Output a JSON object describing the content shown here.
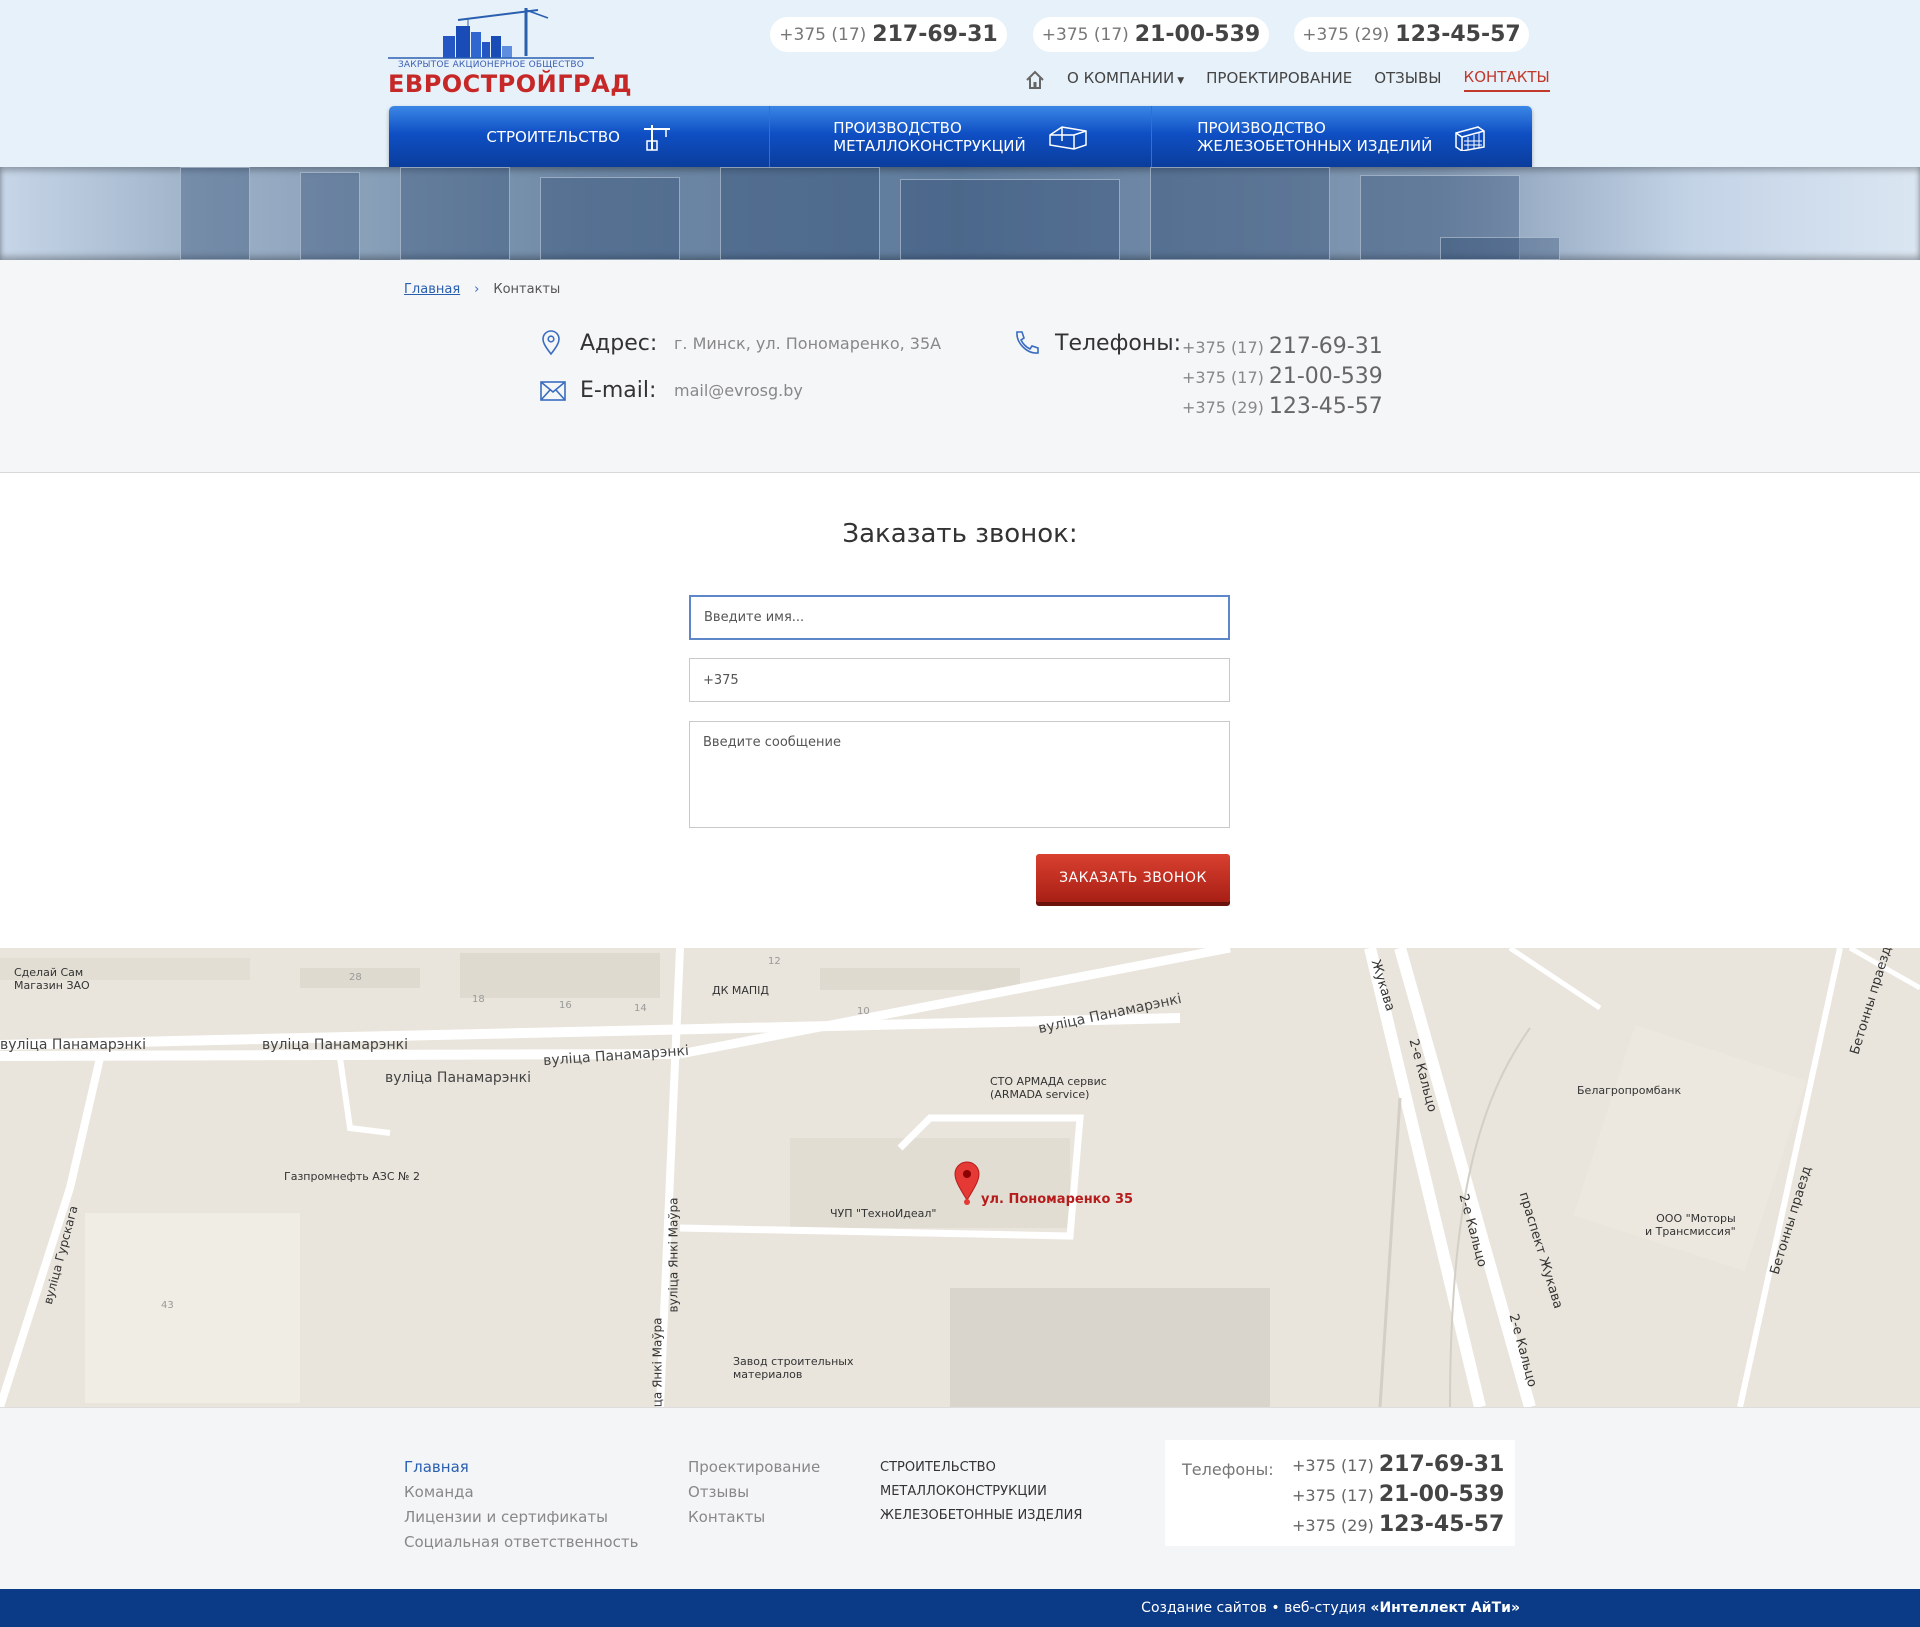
{
  "header": {
    "logo_subtitle": "ЗАКРЫТОЕ АКЦИОНЕРНОЕ ОБЩЕСТВО",
    "logo_name": "ЕВРОСТРОЙГРАД",
    "phones": [
      {
        "code": "+375 (17)",
        "number": "217-69-31"
      },
      {
        "code": "+375 (17)",
        "number": "21-00-539"
      },
      {
        "code": "+375 (29)",
        "number": "123-45-57"
      }
    ],
    "topnav": {
      "about": "О КОМПАНИИ",
      "design": "ПРОЕКТИРОВАНИЕ",
      "reviews": "ОТЗЫВЫ",
      "contacts": "КОНТАКТЫ"
    },
    "mainnav": {
      "construction": "СТРОИТЕЛЬСТВО",
      "metal_line1": "ПРОИЗВОДСТВО",
      "metal_line2": "МЕТАЛЛОКОНСТРУКЦИЙ",
      "concrete_line1": "ПРОИЗВОДСТВО",
      "concrete_line2": "ЖЕЛЕЗОБЕТОННЫХ ИЗДЕЛИЙ"
    }
  },
  "breadcrumb": {
    "home": "Главная",
    "current": "Контакты"
  },
  "contact": {
    "address_label": "Адрес:",
    "address_value": "г. Минск, ул. Пономаренко, 35А",
    "email_label": "E-mail:",
    "email_value": "mail@evrosg.by",
    "phones_label": "Телефоны:",
    "phones": [
      {
        "code": "+375 (17)",
        "number": "217-69-31"
      },
      {
        "code": "+375 (17)",
        "number": "21-00-539"
      },
      {
        "code": "+375 (29)",
        "number": "123-45-57"
      }
    ]
  },
  "form": {
    "title": "Заказать звонок:",
    "name_placeholder": "Введите имя...",
    "phone_value": "+375",
    "message_placeholder": "Введите сообщение",
    "submit": "ЗАКАЗАТЬ ЗВОНОК"
  },
  "map": {
    "pin_label": "ул. Пономаренко 35",
    "streets": {
      "panamarenki": "вуліца Панамарэнкі",
      "jankimaura": "вуліца Янкі Маўра",
      "gurskaga": "вуліца Гурскага",
      "kalco": "2-е Кальцо",
      "zhukava": "праспект Жукава",
      "betonny": "Бетонны праезд",
      "zhukava_short": "Жукава"
    },
    "places": {
      "sdelai_line1": "Сделай Сам",
      "sdelai_line2": "Магазин ЗАО",
      "dk": "ДК МАПІД",
      "sto_line1": "СТО АРМАДА сервис",
      "sto_line2": "(ARMADA service)",
      "azs": "Газпромнефть АЗС № 2",
      "technoideal": "ЧУП \"ТехноИдеал\"",
      "bank": "Белагропромбанк",
      "motors_line1": "ООО \"Моторы",
      "motors_line2": "и Трансмиссия\"",
      "zavod_line1": "Завод строительных",
      "zavod_line2": "материалов"
    },
    "numbers": {
      "n28": "28",
      "n18": "18",
      "n16": "16",
      "n14": "14",
      "n12": "12",
      "n10": "10",
      "n43": "43"
    }
  },
  "footer": {
    "col1": [
      "Главная",
      "Команда",
      "Лицензии и сертификаты",
      "Социальная ответственность"
    ],
    "col2": [
      "Проектирование",
      "Отзывы",
      "Контакты"
    ],
    "col3": [
      "СТРОИТЕЛЬСТВО",
      "МЕТАЛЛОКОНСТРУКЦИИ",
      "ЖЕЛЕЗОБЕТОННЫЕ ИЗДЕЛИЯ"
    ],
    "phones_label": "Телефоны:",
    "phones": [
      {
        "code": "+375 (17)",
        "number": "217-69-31"
      },
      {
        "code": "+375 (17)",
        "number": "21-00-539"
      },
      {
        "code": "+375 (29)",
        "number": "123-45-57"
      }
    ],
    "credit_prefix": "Создание сайтов",
    "credit_middle": "веб-студия",
    "credit_studio": "«Интеллект АйТи»"
  },
  "colors": {
    "brand_blue": "#0f4fc4",
    "brand_red": "#c62828",
    "footer_bar": "#0b3a86"
  }
}
